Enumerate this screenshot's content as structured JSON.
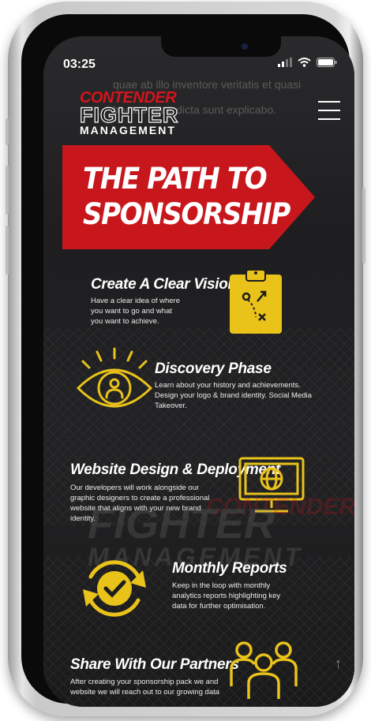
{
  "status_bar": {
    "time": "03:25"
  },
  "background_text": {
    "line1": "quae ab illo inventore veritatis et quasi",
    "line2": "beatae vitae dicta sunt explicabo."
  },
  "logo": {
    "line1": "CONTENDER",
    "line2": "FIGHTER",
    "line3": "MANAGEMENT"
  },
  "banner": {
    "line1": "THE PATH TO",
    "line2": "SPONSORSHIP"
  },
  "steps": [
    {
      "title": "Create A Clear Vision",
      "desc": "Have a clear idea of where you want to go and what you want to achieve.",
      "icon": "clipboard-strategy-icon"
    },
    {
      "title": "Discovery Phase",
      "desc": "Learn about your history and achievements. Design your logo & brand identity. Social Media Takeover.",
      "icon": "eye-person-icon"
    },
    {
      "title": "Website Design & Deployment",
      "desc": "Our developers will work alongside our graphic designers to create a professional website that aligns with your new brand identity.",
      "icon": "monitor-globe-icon"
    },
    {
      "title": "Monthly Reports",
      "desc": "Keep in the loop with monthly analytics reports highlighting key data for further optimisation.",
      "icon": "refresh-check-icon"
    },
    {
      "title": "Share With Our Partners",
      "desc": "After creating your sponsorship pack we and website we will reach out to our growing data",
      "icon": "team-people-icon"
    }
  ],
  "colors": {
    "accent_red": "#d8141b",
    "accent_yellow": "#e9c21a",
    "background": "#1c1c1e"
  }
}
